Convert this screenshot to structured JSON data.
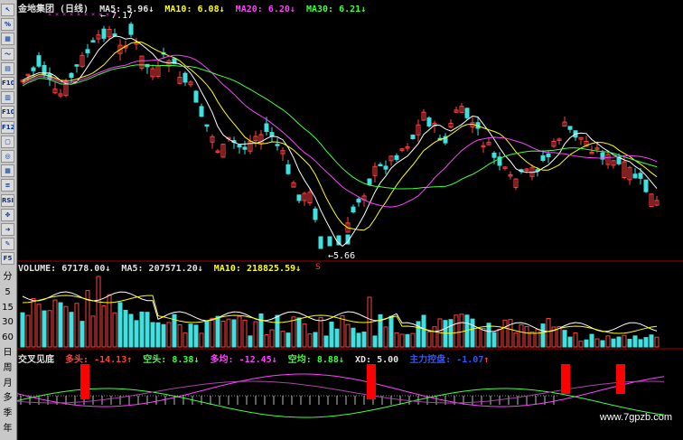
{
  "toolbar": {
    "buttons": [
      {
        "name": "cursor-icon",
        "label": "↖"
      },
      {
        "name": "percent-icon",
        "label": "%"
      },
      {
        "name": "info-icon",
        "label": "▦"
      },
      {
        "name": "line-chart-icon",
        "label": "〜"
      },
      {
        "name": "bar-chart-icon",
        "label": "▤"
      },
      {
        "name": "f10-button",
        "label": "F10"
      },
      {
        "name": "financial-icon",
        "label": "▥"
      },
      {
        "name": "f10b-button",
        "label": "F10"
      },
      {
        "name": "f12-button",
        "label": "F12"
      },
      {
        "name": "window-icon",
        "label": "▢"
      },
      {
        "name": "search-icon",
        "label": "◎"
      },
      {
        "name": "grid-icon",
        "label": "▦"
      },
      {
        "name": "indicator-icon",
        "label": "≡"
      },
      {
        "name": "rsi-button",
        "label": "RSI"
      },
      {
        "name": "move-icon",
        "label": "✥"
      },
      {
        "name": "export-icon",
        "label": "➜"
      },
      {
        "name": "pencil-icon",
        "label": "✎"
      },
      {
        "name": "f5-button",
        "label": "F5"
      }
    ],
    "periods": [
      "分",
      "5",
      "15",
      "30",
      "60",
      "日",
      "周",
      "月",
      "多",
      "季",
      "年"
    ]
  },
  "header": {
    "stock": "金地集团 (日线)",
    "ma5_label": "MA5:",
    "ma5_value": "5.96",
    "ma5_arrow": "↓",
    "ma10_label": "MA10:",
    "ma10_value": "6.08",
    "ma10_arrow": "↓",
    "ma20_label": "MA20:",
    "ma20_value": "6.20",
    "ma20_arrow": "↓",
    "ma30_label": "MA30:",
    "ma30_value": "6.21",
    "ma30_arrow": "↓"
  },
  "price": {
    "high_label": "7.17",
    "low_label": "5.66",
    "marker": "S"
  },
  "volume": {
    "label": "VOLUME:",
    "value": "67178.00",
    "arrow": "↓",
    "ma5_label": "MA5:",
    "ma5_value": "207571.20",
    "ma5_arrow": "↓",
    "ma10_label": "MA10:",
    "ma10_value": "218825.59",
    "ma10_arrow": "↓",
    "scale": [
      "5",
      "40",
      "20",
      "60",
      "40",
      "20"
    ]
  },
  "indicator": {
    "name": "交叉见底",
    "duotou_label": "多头:",
    "duotou_value": "-14.13",
    "duotou_arrow": "↑",
    "kongtou_label": "空头:",
    "kongtou_value": "8.38",
    "kongtou_arrow": "↓",
    "duojun_label": "多均:",
    "duojun_value": "-12.45",
    "duojun_arrow": "↓",
    "kongjun_label": "空均:",
    "kongjun_value": "8.88",
    "kongjun_arrow": "↓",
    "xd_label": "XD:",
    "xd_value": "5.00",
    "zhuli_label": "主力控盘:",
    "zhuli_value": "-1.07",
    "zhuli_arrow": "↑"
  },
  "colors": {
    "up": "#ff4040",
    "down": "#40e0e0",
    "ma5": "#ffffff",
    "ma10": "#ffff00",
    "ma20": "#ff40ff",
    "ma30": "#40ff40",
    "volume_up": "#ff4040",
    "volume_down": "#40e0e0"
  },
  "watermark": "www.7gpzb.com"
}
